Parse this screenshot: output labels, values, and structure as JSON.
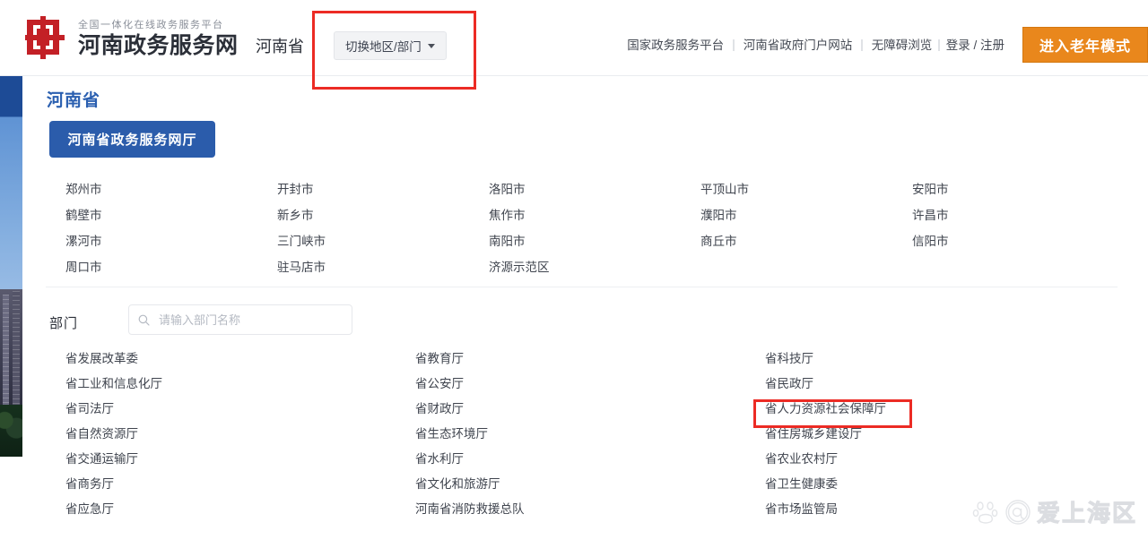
{
  "header": {
    "logo_sup": "全国一体化在线政务服务平台",
    "logo_title": "河南政务服务网",
    "logo_icon": "ding-vessel-logo-icon",
    "region_label": "河南省",
    "switch_button": "切换地区/部门",
    "switch_caret_icon": "chevron-down-icon",
    "links": [
      {
        "label": "国家政务服务平台"
      },
      {
        "label": "河南省政府门户网站"
      },
      {
        "label": "无障碍浏览"
      },
      {
        "label": "登录 / 注册"
      }
    ],
    "separator": "|",
    "elder_mode_button": "进入老年模式",
    "elder_mode_color": "#e9871c"
  },
  "panel": {
    "province_title": "河南省",
    "province_title_color": "#2a5fb0",
    "portal_button": "河南省政务服务网厅",
    "portal_button_color": "#2b5cab",
    "cities": [
      "郑州市",
      "鹤壁市",
      "漯河市",
      "周口市",
      "开封市",
      "新乡市",
      "三门峡市",
      "驻马店市",
      "洛阳市",
      "焦作市",
      "南阳市",
      "济源示范区",
      "平顶山市",
      "濮阳市",
      "商丘市",
      "",
      "安阳市",
      "许昌市",
      "信阳市",
      ""
    ],
    "department_section": {
      "label": "部门",
      "search_placeholder": "请输入部门名称",
      "search_value": "",
      "search_icon": "search-icon",
      "departments": [
        "省发展改革委",
        "省工业和信息化厅",
        "省司法厅",
        "省自然资源厅",
        "省交通运输厅",
        "省商务厅",
        "省应急厅",
        "省教育厅",
        "省公安厅",
        "省财政厅",
        "省生态环境厅",
        "省水利厅",
        "省文化和旅游厅",
        "河南省消防救援总队",
        "省科技厅",
        "省民政厅",
        "省人力资源社会保障厅",
        "省住房城乡建设厅",
        "省农业农村厅",
        "省卫生健康委",
        "省市场监管局"
      ]
    }
  },
  "annotations": {
    "color": "#ec2b24",
    "boxes": [
      {
        "target": "切换地区/部门"
      },
      {
        "target": "省人力资源社会保障厅"
      }
    ]
  },
  "watermark": {
    "icon": "baidu-paw-icon",
    "at_icon": "at-sign-icon",
    "text": "爱上海区"
  }
}
